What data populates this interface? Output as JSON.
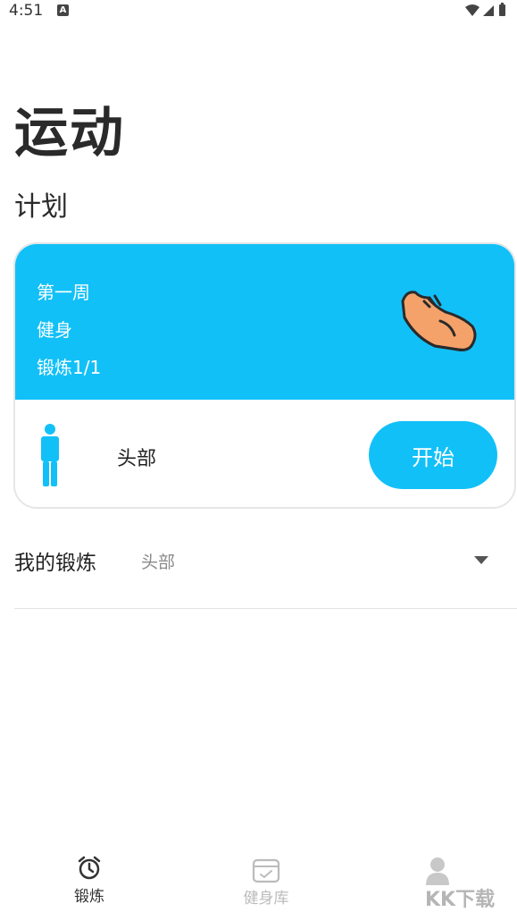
{
  "status": {
    "time": "4:51",
    "notification_letter": "A"
  },
  "page": {
    "title": "运动",
    "section": "计划"
  },
  "plan_card": {
    "week": "第一周",
    "type": "健身",
    "progress": "锻炼1/1",
    "body_part": "头部",
    "start_label": "开始"
  },
  "my_exercise": {
    "label": "我的锻炼",
    "selected": "头部"
  },
  "bottom_nav": [
    {
      "label": "锻炼"
    },
    {
      "label": "健身库"
    },
    {
      "label": ""
    }
  ],
  "watermark": "KK下载",
  "colors": {
    "accent": "#12c0f8",
    "shoe": "#f4a26a"
  }
}
